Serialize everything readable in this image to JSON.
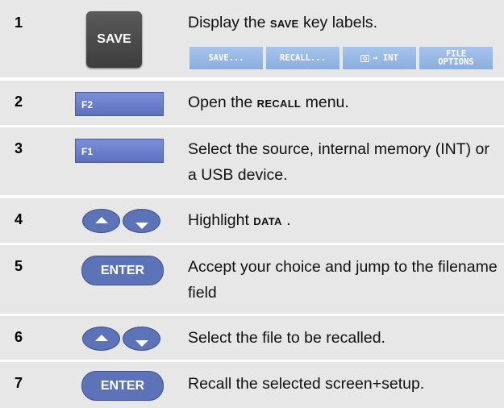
{
  "steps": [
    {
      "num": "1",
      "text_pre": "Display the ",
      "text_key": "SAVE",
      "text_post": " key labels.",
      "control": "SAVE"
    },
    {
      "num": "2",
      "text_pre": "Open the ",
      "text_key": "RECALL",
      "text_post": " menu.",
      "control": "F2"
    },
    {
      "num": "3",
      "text_pre": "Select the source, internal memory (INT) or a USB device.",
      "text_key": "",
      "text_post": "",
      "control": "F1"
    },
    {
      "num": "4",
      "text_pre": "Highlight ",
      "text_key": "DATA",
      "text_post": " .",
      "control": "arrows"
    },
    {
      "num": "5",
      "text_pre": "Accept your choice and jump to the filename field",
      "text_key": "",
      "text_post": "",
      "control": "ENTER"
    },
    {
      "num": "6",
      "text_pre": "Select the file to be recalled.",
      "text_key": "",
      "text_post": "",
      "control": "arrows"
    },
    {
      "num": "7",
      "text_pre": "Recall the selected screen+setup.",
      "text_key": "",
      "text_post": "",
      "control": "ENTER"
    }
  ],
  "softkeys": {
    "k1": "SAVE...",
    "k2": "RECALL...",
    "k3": "→ INT",
    "k4_line1": "FILE",
    "k4_line2": "OPTIONS"
  },
  "icons": {
    "camera": "camera-icon",
    "up": "up-arrow-icon",
    "down": "down-arrow-icon"
  },
  "colors": {
    "row_bg": "#e7e7e8",
    "key_blue": "#5d73b8",
    "softkey_blue": "#8aaee0"
  }
}
